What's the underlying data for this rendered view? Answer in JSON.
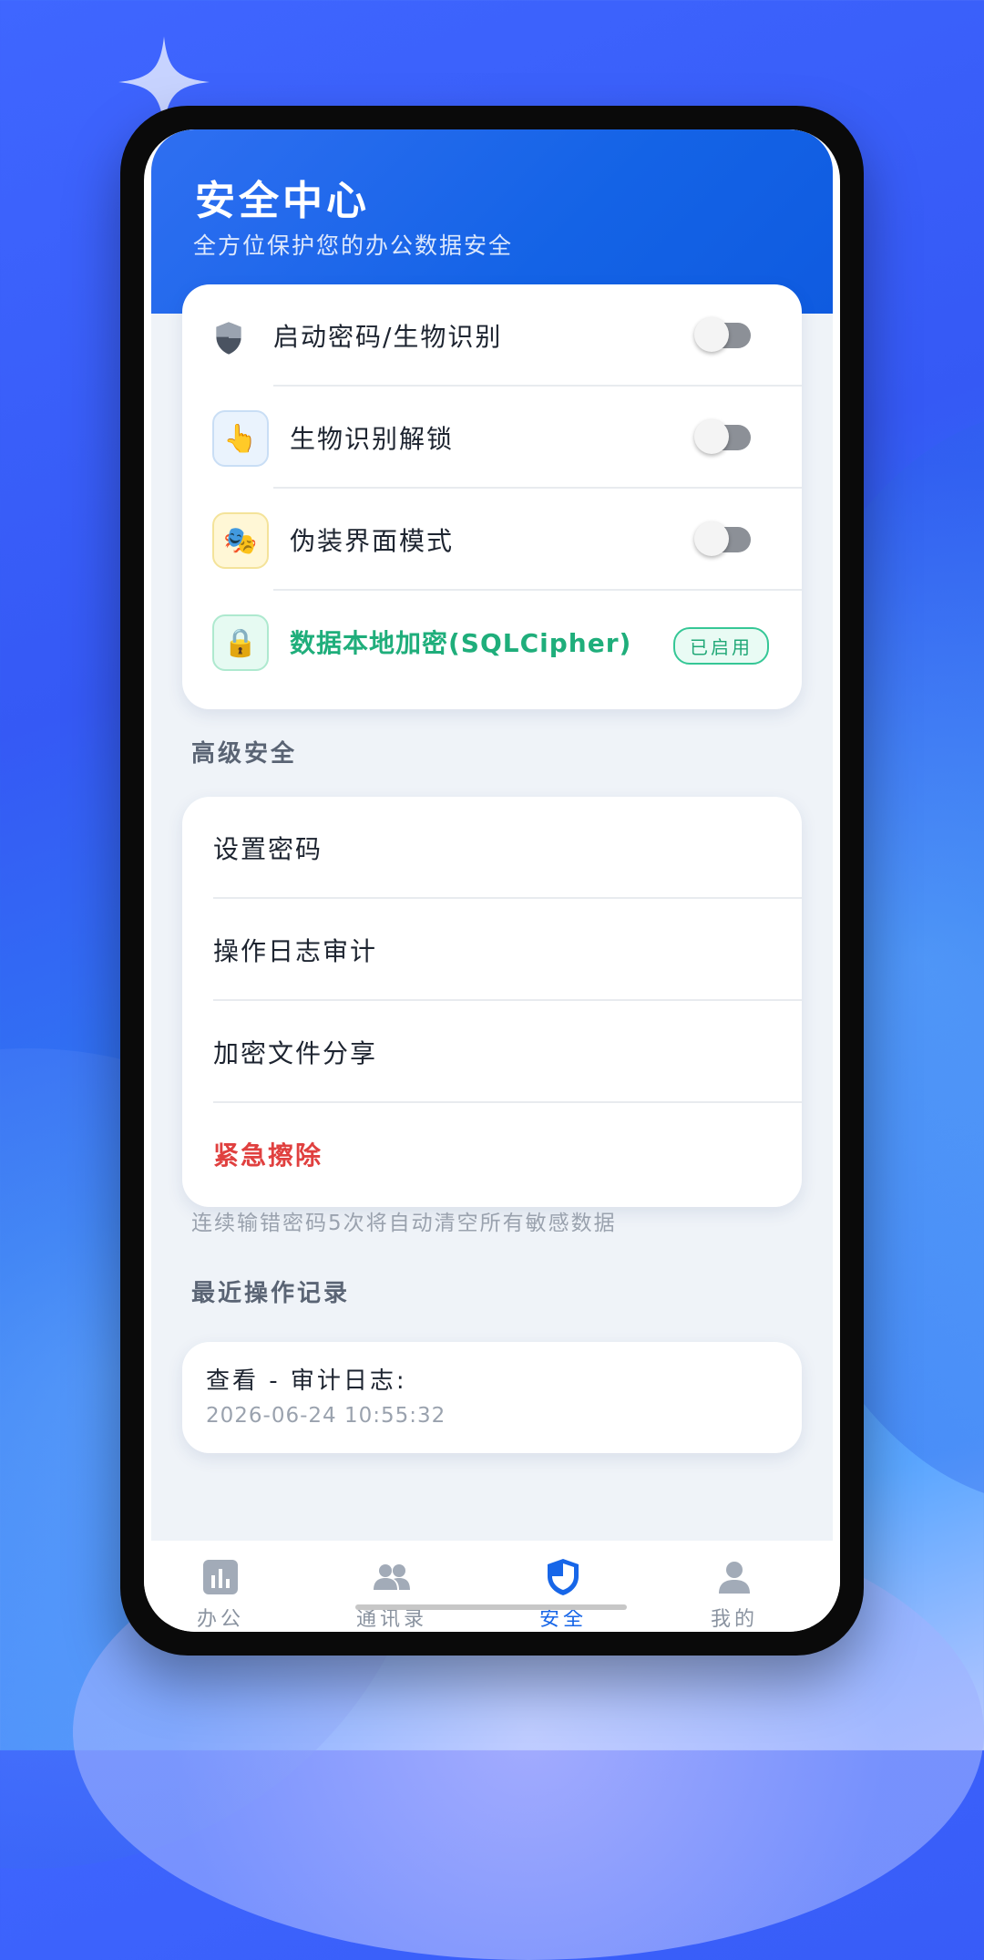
{
  "header": {
    "title": "安全中心",
    "subtitle": "全方位保护您的办公数据安全"
  },
  "security_settings": [
    {
      "label": "启动密码/生物识别",
      "icon": "shield-icon",
      "toggle": "off"
    },
    {
      "label": "生物识别解锁",
      "icon": "pointing-hand-icon",
      "toggle": "off"
    },
    {
      "label": "伪装界面模式",
      "icon": "theater-masks-icon",
      "toggle": "off"
    },
    {
      "label": "数据本地加密(SQLCipher)",
      "icon": "lock-icon",
      "badge": "已启用",
      "color": "#1fae7b"
    }
  ],
  "advanced": {
    "title": "高级安全",
    "items": [
      {
        "label": "设置密码"
      },
      {
        "label": "操作日志审计"
      },
      {
        "label": "加密文件分享"
      },
      {
        "label": "紧急擦除",
        "color": "#e0403f"
      }
    ],
    "note": "连续输错密码5次将自动清空所有敏感数据"
  },
  "recent": {
    "title": "最近操作记录",
    "items": [
      {
        "action": "查看 - 审计日志:",
        "time": "2026-06-24 10:55:32"
      }
    ]
  },
  "tabs": [
    {
      "label": "办公",
      "icon": "chart-icon"
    },
    {
      "label": "通讯录",
      "icon": "contacts-icon"
    },
    {
      "label": "安全",
      "icon": "shield-icon",
      "active": true
    },
    {
      "label": "我的",
      "icon": "person-icon"
    }
  ],
  "colors": {
    "accent": "#1766e8",
    "success": "#1fae7b",
    "danger": "#e0403f"
  }
}
